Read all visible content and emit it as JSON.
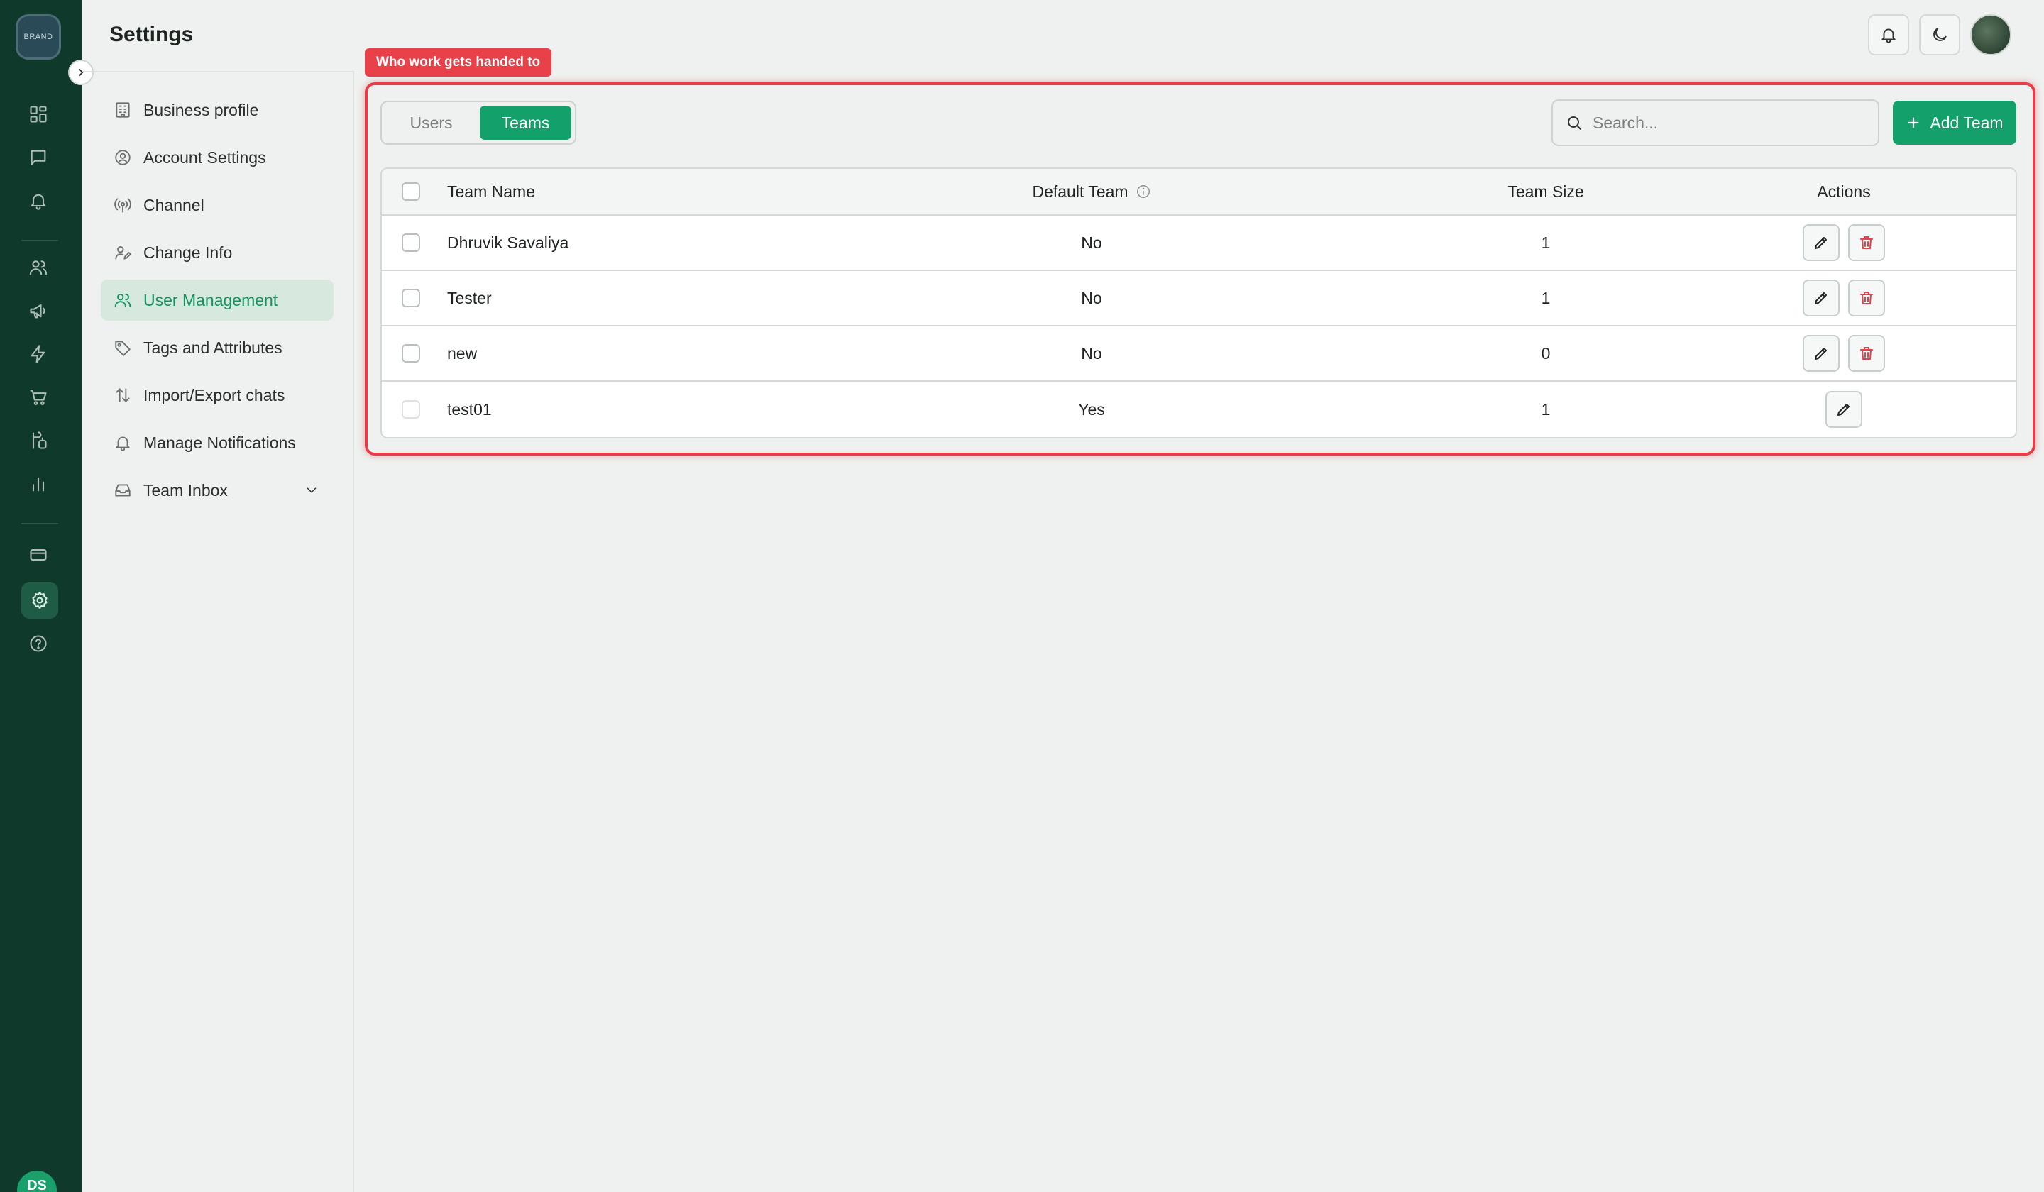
{
  "header": {
    "title": "Settings"
  },
  "rail": {
    "logo_text": "BRAND",
    "avatar_initials": "DS"
  },
  "settings_nav": {
    "items": [
      {
        "label": "Business profile",
        "icon": "building-icon"
      },
      {
        "label": "Account Settings",
        "icon": "user-circle-icon"
      },
      {
        "label": "Channel",
        "icon": "broadcast-icon"
      },
      {
        "label": "Change Info",
        "icon": "user-edit-icon"
      },
      {
        "label": "User Management",
        "icon": "users-icon",
        "active": true
      },
      {
        "label": "Tags and Attributes",
        "icon": "tag-icon"
      },
      {
        "label": "Import/Export chats",
        "icon": "arrows-updown-icon"
      },
      {
        "label": "Manage Notifications",
        "icon": "bell-icon"
      },
      {
        "label": "Team Inbox",
        "icon": "inbox-icon",
        "expandable": true
      }
    ]
  },
  "tooltip": {
    "text": "Who work gets handed to"
  },
  "tabs": {
    "users": "Users",
    "teams": "Teams",
    "active": "teams"
  },
  "search": {
    "placeholder": "Search...",
    "value": ""
  },
  "add_button": {
    "label": "Add Team"
  },
  "table": {
    "columns": {
      "name": "Team Name",
      "default": "Default Team",
      "size": "Team Size",
      "actions": "Actions"
    },
    "rows": [
      {
        "name": "Dhruvik Savaliya",
        "default": "No",
        "size": "1",
        "deletable": true
      },
      {
        "name": "Tester",
        "default": "No",
        "size": "1",
        "deletable": true
      },
      {
        "name": "new",
        "default": "No",
        "size": "0",
        "deletable": true
      },
      {
        "name": "test01",
        "default": "Yes",
        "size": "1",
        "deletable": false
      }
    ]
  },
  "colors": {
    "rail_bg": "#0f3a2b",
    "accent": "#13a06a",
    "highlight": "#e83d46",
    "delete": "#e0434b"
  }
}
